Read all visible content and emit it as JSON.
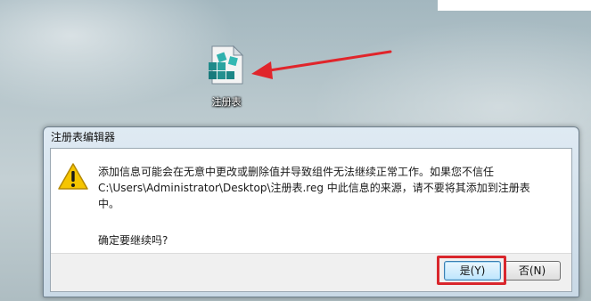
{
  "desktop": {
    "icon": {
      "name": "registry-file-icon",
      "label": "注册表"
    },
    "annotation_color": "#e0252b"
  },
  "dialog": {
    "title": "注册表编辑器",
    "warning_icon": "warning-triangle-icon",
    "message_lines": [
      "添加信息可能会在无意中更改或删除值并导致组件无法继续正常工作。如果您不信任",
      "C:\\Users\\Administrator\\Desktop\\注册表.reg 中此信息的来源，请不要将其添加到注册表",
      "中。"
    ],
    "question": "确定要继续吗?",
    "buttons": {
      "yes_label": "是(Y)",
      "no_label": "否(N)"
    }
  }
}
